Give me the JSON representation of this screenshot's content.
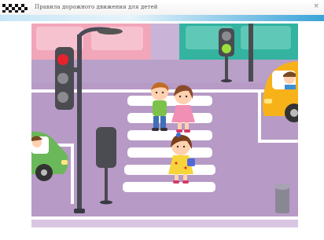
{
  "window": {
    "title": "Правила дорожного движения для детей",
    "close_glyph": "×"
  },
  "scene": {
    "icons": [
      "traffic-light-icon",
      "pedestrian-light-icon",
      "taxi-icon",
      "car-icon",
      "street-lamp-icon",
      "children-icon",
      "trash-can-icon"
    ],
    "colors": {
      "road": "#b79ac5",
      "sidewalk": "#e3d6ea",
      "crosswalk": "#ffffff",
      "pink_building": "#f2a6b9",
      "teal_building": "#33b3a0",
      "taxi": "#f7b21a",
      "green_car": "#6ab85a",
      "accent": "#3aa3d8"
    }
  }
}
